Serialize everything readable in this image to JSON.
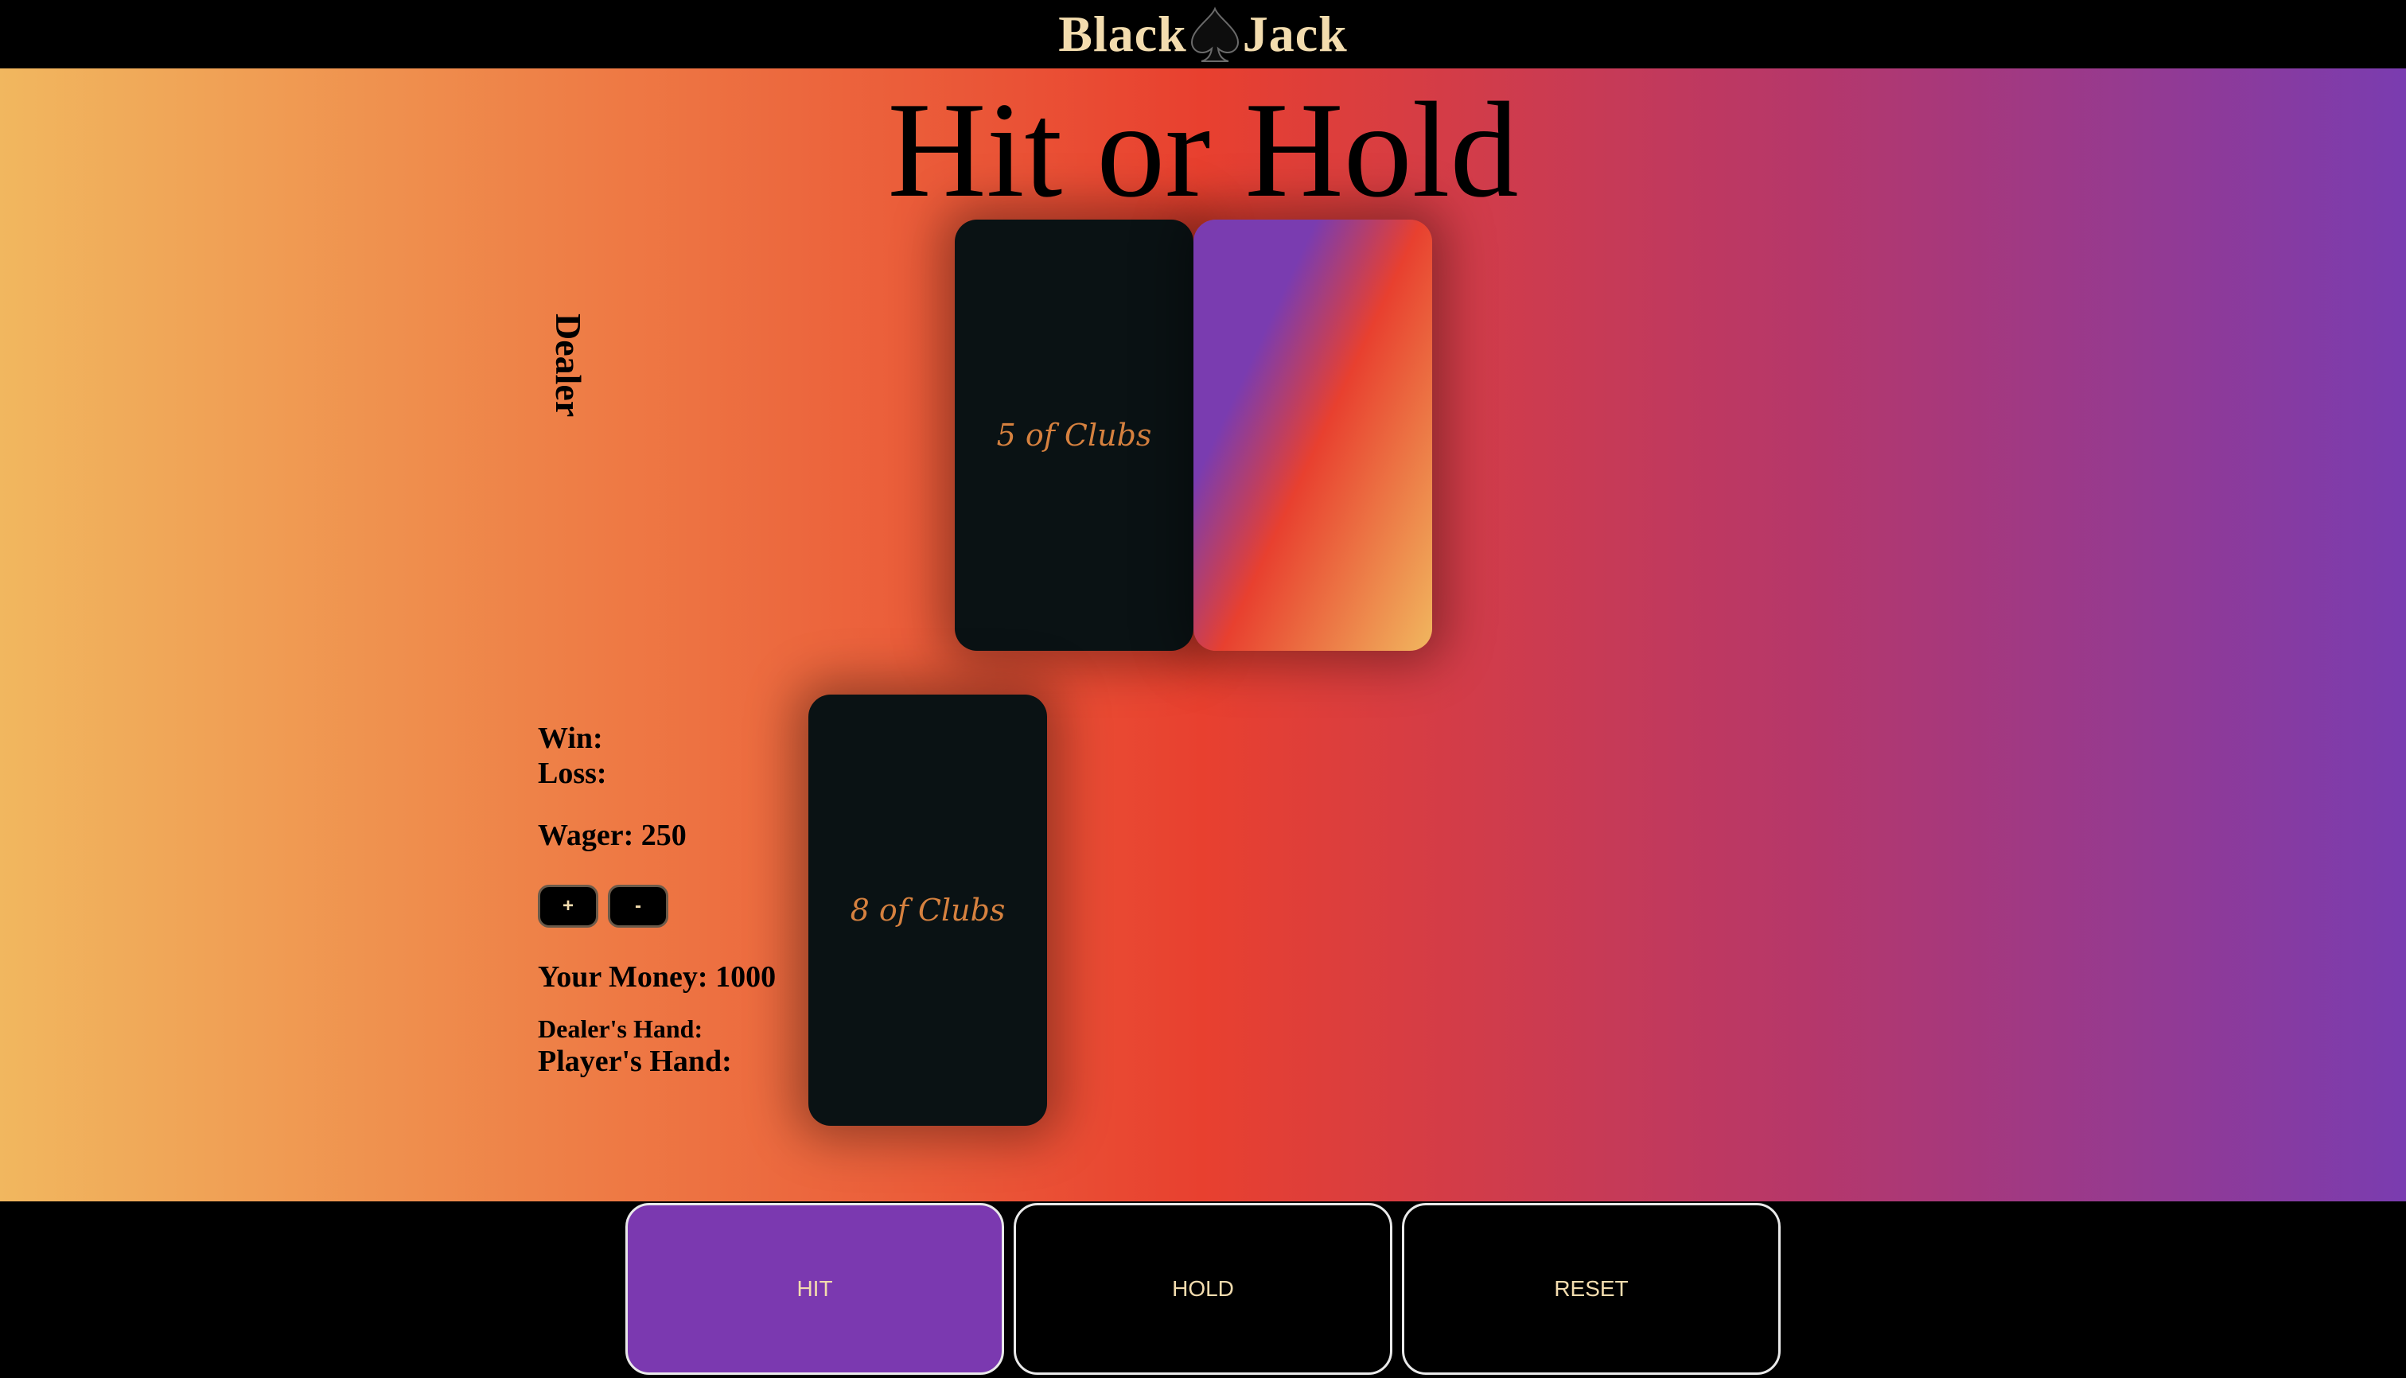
{
  "header": {
    "logo_left": "Black",
    "logo_right": "Jack",
    "logo_icon": "spade-icon"
  },
  "main": {
    "title": "Hit or Hold",
    "dealer_label": "Dealer",
    "dealer_cards": [
      {
        "label": "5 of Clubs",
        "face_up": true
      },
      {
        "label": "",
        "face_up": false
      }
    ],
    "player_cards": [
      {
        "label": "8 of Clubs",
        "face_up": true
      }
    ]
  },
  "stats": {
    "win_label": "Win:",
    "loss_label": "Loss:",
    "wager_label": "Wager: 250",
    "increase_label": "+",
    "decrease_label": "-",
    "money_label": "Your Money: 1000",
    "dealer_hand_label": "Dealer's Hand:",
    "player_hand_label": "Player's Hand:"
  },
  "actions": {
    "hit_label": "HIT",
    "hold_label": "HOLD",
    "reset_label": "RESET",
    "active": "HIT"
  },
  "colors": {
    "accent_purple": "#7b39b0",
    "card_face": "#0a1214",
    "card_text": "#d6813f",
    "logo_text": "#f3dcae",
    "gradient_start": "#f1b75f",
    "gradient_mid": "#e8402f",
    "gradient_end": "#7a3cb0"
  }
}
